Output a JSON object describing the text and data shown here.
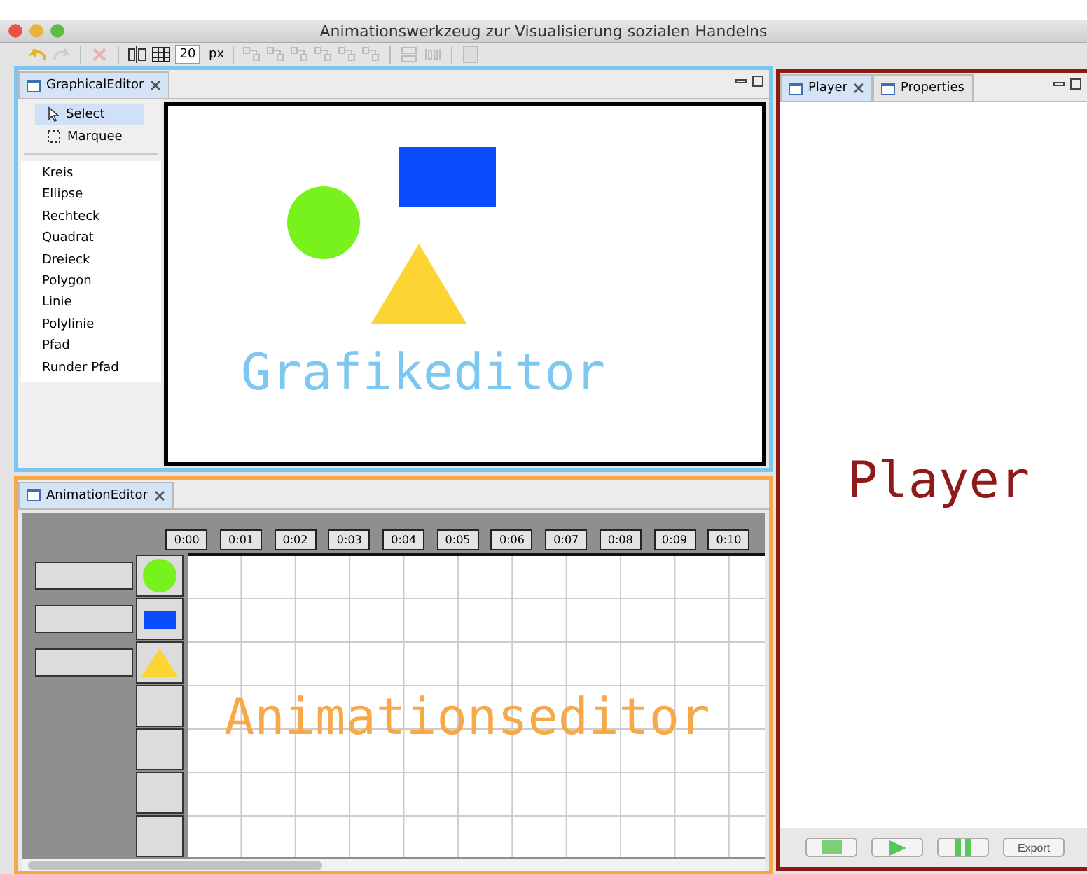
{
  "window": {
    "title": "Animationswerkzeug zur Visualisierung sozialen Handelns"
  },
  "toolbar": {
    "grid_size": "20",
    "unit": "px"
  },
  "graphical_editor": {
    "tab": {
      "label": "GraphicalEditor",
      "selected": true
    },
    "tools": [
      {
        "label": "Select",
        "selected": true
      },
      {
        "label": "Marquee",
        "selected": false
      }
    ],
    "shape_tools": [
      "Kreis",
      "Ellipse",
      "Rechteck",
      "Quadrat",
      "Dreieck",
      "Polygon",
      "Linie",
      "Polylinie",
      "Pfad",
      "Runder Pfad"
    ],
    "shapes": [
      {
        "kind": "circle",
        "color": "#78f21c"
      },
      {
        "kind": "rect",
        "color": "#0a4cff"
      },
      {
        "kind": "triangle",
        "color": "#fcd535"
      }
    ],
    "overlay_label": "Grafikeditor"
  },
  "animation_editor": {
    "tab": {
      "label": "AnimationEditor",
      "selected": true
    },
    "time_labels": [
      "0:00",
      "0:01",
      "0:02",
      "0:03",
      "0:04",
      "0:05",
      "0:06",
      "0:07",
      "0:08",
      "0:09",
      "0:10"
    ],
    "tracks": [
      {
        "kind": "circle",
        "color": "#78f21c"
      },
      {
        "kind": "rect",
        "color": "#0a4cff"
      },
      {
        "kind": "triangle",
        "color": "#fcd535"
      },
      {
        "kind": "empty"
      },
      {
        "kind": "empty"
      },
      {
        "kind": "empty"
      },
      {
        "kind": "empty"
      }
    ],
    "overlay_label": "Animationseditor"
  },
  "player": {
    "tabs": [
      {
        "label": "Player",
        "selected": true
      },
      {
        "label": "Properties",
        "selected": false
      }
    ],
    "overlay_label": "Player",
    "controls": [
      {
        "kind": "stop"
      },
      {
        "kind": "play"
      },
      {
        "kind": "pause"
      },
      {
        "kind": "text",
        "label": "Export"
      }
    ]
  }
}
